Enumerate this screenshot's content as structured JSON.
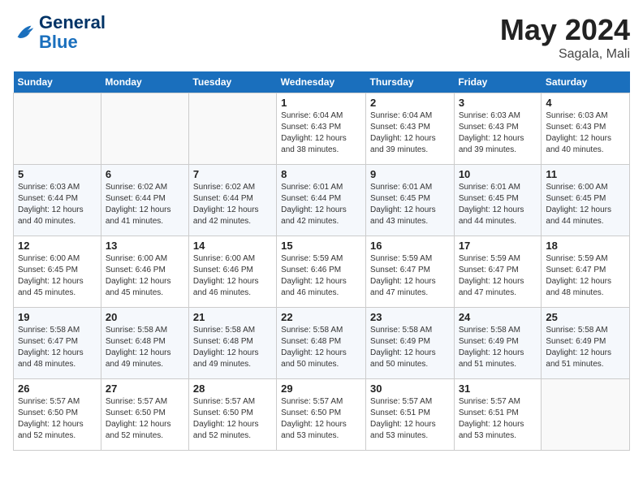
{
  "header": {
    "logo_line1": "General",
    "logo_line2": "Blue",
    "month": "May 2024",
    "location": "Sagala, Mali"
  },
  "weekdays": [
    "Sunday",
    "Monday",
    "Tuesday",
    "Wednesday",
    "Thursday",
    "Friday",
    "Saturday"
  ],
  "weeks": [
    [
      {
        "day": "",
        "info": ""
      },
      {
        "day": "",
        "info": ""
      },
      {
        "day": "",
        "info": ""
      },
      {
        "day": "1",
        "info": "Sunrise: 6:04 AM\nSunset: 6:43 PM\nDaylight: 12 hours and 38 minutes."
      },
      {
        "day": "2",
        "info": "Sunrise: 6:04 AM\nSunset: 6:43 PM\nDaylight: 12 hours and 39 minutes."
      },
      {
        "day": "3",
        "info": "Sunrise: 6:03 AM\nSunset: 6:43 PM\nDaylight: 12 hours and 39 minutes."
      },
      {
        "day": "4",
        "info": "Sunrise: 6:03 AM\nSunset: 6:43 PM\nDaylight: 12 hours and 40 minutes."
      }
    ],
    [
      {
        "day": "5",
        "info": "Sunrise: 6:03 AM\nSunset: 6:44 PM\nDaylight: 12 hours and 40 minutes."
      },
      {
        "day": "6",
        "info": "Sunrise: 6:02 AM\nSunset: 6:44 PM\nDaylight: 12 hours and 41 minutes."
      },
      {
        "day": "7",
        "info": "Sunrise: 6:02 AM\nSunset: 6:44 PM\nDaylight: 12 hours and 42 minutes."
      },
      {
        "day": "8",
        "info": "Sunrise: 6:01 AM\nSunset: 6:44 PM\nDaylight: 12 hours and 42 minutes."
      },
      {
        "day": "9",
        "info": "Sunrise: 6:01 AM\nSunset: 6:45 PM\nDaylight: 12 hours and 43 minutes."
      },
      {
        "day": "10",
        "info": "Sunrise: 6:01 AM\nSunset: 6:45 PM\nDaylight: 12 hours and 44 minutes."
      },
      {
        "day": "11",
        "info": "Sunrise: 6:00 AM\nSunset: 6:45 PM\nDaylight: 12 hours and 44 minutes."
      }
    ],
    [
      {
        "day": "12",
        "info": "Sunrise: 6:00 AM\nSunset: 6:45 PM\nDaylight: 12 hours and 45 minutes."
      },
      {
        "day": "13",
        "info": "Sunrise: 6:00 AM\nSunset: 6:46 PM\nDaylight: 12 hours and 45 minutes."
      },
      {
        "day": "14",
        "info": "Sunrise: 6:00 AM\nSunset: 6:46 PM\nDaylight: 12 hours and 46 minutes."
      },
      {
        "day": "15",
        "info": "Sunrise: 5:59 AM\nSunset: 6:46 PM\nDaylight: 12 hours and 46 minutes."
      },
      {
        "day": "16",
        "info": "Sunrise: 5:59 AM\nSunset: 6:47 PM\nDaylight: 12 hours and 47 minutes."
      },
      {
        "day": "17",
        "info": "Sunrise: 5:59 AM\nSunset: 6:47 PM\nDaylight: 12 hours and 47 minutes."
      },
      {
        "day": "18",
        "info": "Sunrise: 5:59 AM\nSunset: 6:47 PM\nDaylight: 12 hours and 48 minutes."
      }
    ],
    [
      {
        "day": "19",
        "info": "Sunrise: 5:58 AM\nSunset: 6:47 PM\nDaylight: 12 hours and 48 minutes."
      },
      {
        "day": "20",
        "info": "Sunrise: 5:58 AM\nSunset: 6:48 PM\nDaylight: 12 hours and 49 minutes."
      },
      {
        "day": "21",
        "info": "Sunrise: 5:58 AM\nSunset: 6:48 PM\nDaylight: 12 hours and 49 minutes."
      },
      {
        "day": "22",
        "info": "Sunrise: 5:58 AM\nSunset: 6:48 PM\nDaylight: 12 hours and 50 minutes."
      },
      {
        "day": "23",
        "info": "Sunrise: 5:58 AM\nSunset: 6:49 PM\nDaylight: 12 hours and 50 minutes."
      },
      {
        "day": "24",
        "info": "Sunrise: 5:58 AM\nSunset: 6:49 PM\nDaylight: 12 hours and 51 minutes."
      },
      {
        "day": "25",
        "info": "Sunrise: 5:58 AM\nSunset: 6:49 PM\nDaylight: 12 hours and 51 minutes."
      }
    ],
    [
      {
        "day": "26",
        "info": "Sunrise: 5:57 AM\nSunset: 6:50 PM\nDaylight: 12 hours and 52 minutes."
      },
      {
        "day": "27",
        "info": "Sunrise: 5:57 AM\nSunset: 6:50 PM\nDaylight: 12 hours and 52 minutes."
      },
      {
        "day": "28",
        "info": "Sunrise: 5:57 AM\nSunset: 6:50 PM\nDaylight: 12 hours and 52 minutes."
      },
      {
        "day": "29",
        "info": "Sunrise: 5:57 AM\nSunset: 6:50 PM\nDaylight: 12 hours and 53 minutes."
      },
      {
        "day": "30",
        "info": "Sunrise: 5:57 AM\nSunset: 6:51 PM\nDaylight: 12 hours and 53 minutes."
      },
      {
        "day": "31",
        "info": "Sunrise: 5:57 AM\nSunset: 6:51 PM\nDaylight: 12 hours and 53 minutes."
      },
      {
        "day": "",
        "info": ""
      }
    ]
  ]
}
